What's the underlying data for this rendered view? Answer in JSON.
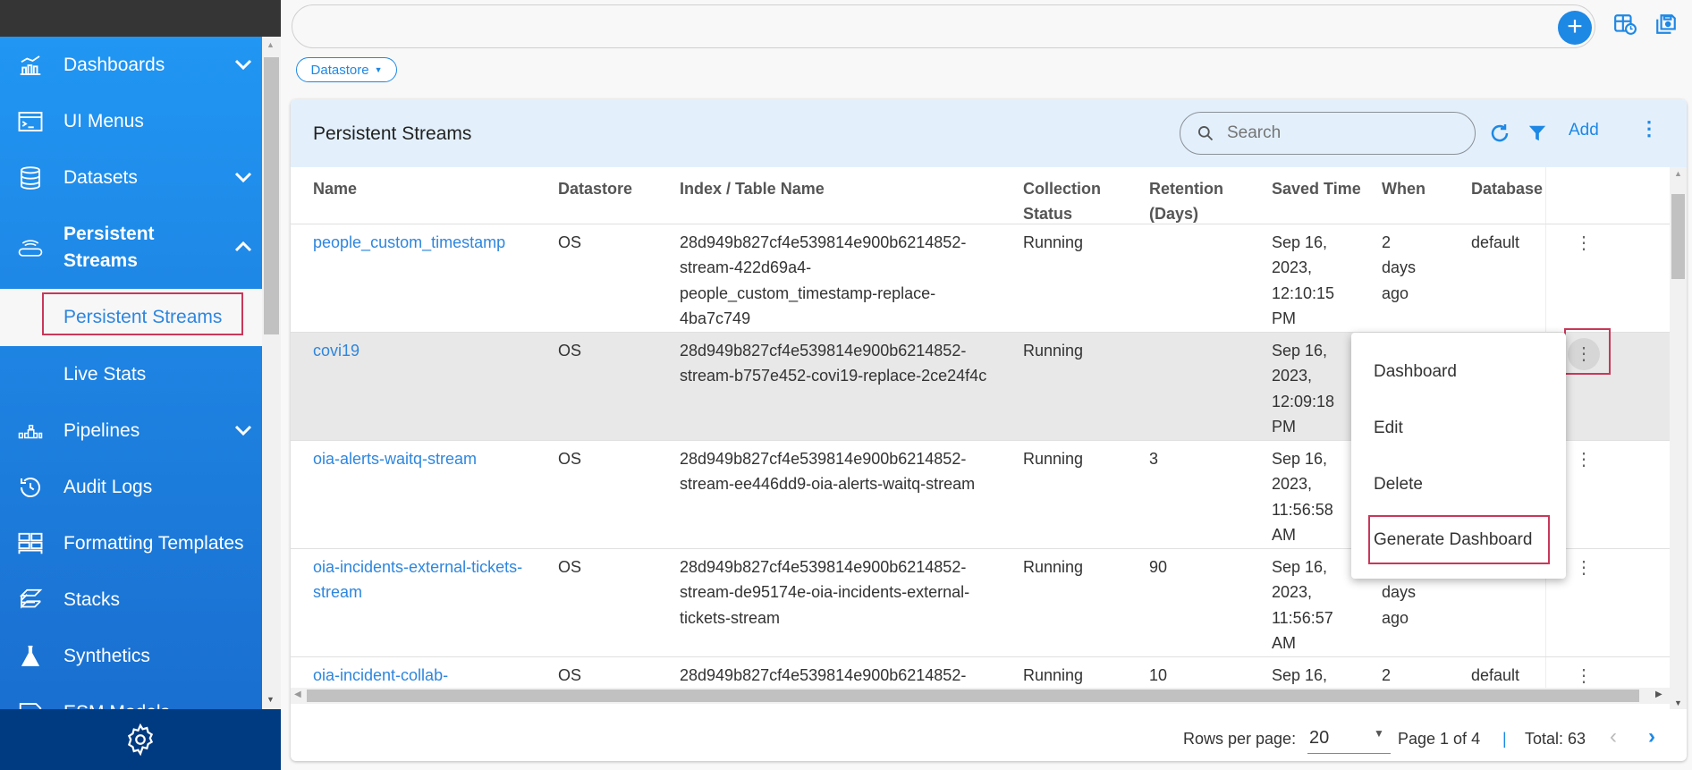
{
  "sidebar": {
    "items": [
      {
        "label": "Dashboards",
        "icon": "bar-chart-icon",
        "chevron": "down"
      },
      {
        "label": "UI Menus",
        "icon": "terminal-window-icon"
      },
      {
        "label": "Datasets",
        "icon": "database-icon",
        "chevron": "down"
      },
      {
        "label": "Persistent Streams",
        "icon": "router-icon",
        "chevron": "up",
        "active": true
      },
      {
        "label": "Persistent Streams",
        "sub": true,
        "selected": true
      },
      {
        "label": "Live Stats",
        "sub": true
      },
      {
        "label": "Pipelines",
        "icon": "pipeline-icon",
        "chevron": "down"
      },
      {
        "label": "Audit Logs",
        "icon": "history-icon"
      },
      {
        "label": "Formatting Templates",
        "icon": "template-icon"
      },
      {
        "label": "Stacks",
        "icon": "stack-icon"
      },
      {
        "label": "Synthetics",
        "icon": "flask-icon"
      },
      {
        "label": "ESM Models",
        "icon": "document-icon"
      }
    ],
    "footer_icon": "settings-gear-icon"
  },
  "toolbar": {
    "chip_label": "Datastore"
  },
  "card": {
    "title": "Persistent Streams",
    "search_placeholder": "Search",
    "add_label": "Add"
  },
  "table": {
    "columns": [
      "Name",
      "Datastore",
      "Index / Table Name",
      "Collection Status",
      "Retention (Days)",
      "Saved Time",
      "When",
      "Database"
    ],
    "rows": [
      {
        "name": "people_custom_timestamp",
        "datastore": "OS",
        "index": "28d949b827cf4e539814e900b6214852-stream-422d69a4-people_custom_timestamp-replace-4ba7c749",
        "status": "Running",
        "retention": "",
        "saved": "Sep 16, 2023, 12:10:15 PM",
        "when": "2 days ago",
        "database": "default"
      },
      {
        "name": "covi19",
        "datastore": "OS",
        "index": "28d949b827cf4e539814e900b6214852-stream-b757e452-covi19-replace-2ce24f4c",
        "status": "Running",
        "retention": "",
        "saved": "Sep 16, 2023, 12:09:18 PM",
        "when": "",
        "database": "",
        "highlighted": true
      },
      {
        "name": "oia-alerts-waitq-stream",
        "datastore": "OS",
        "index": "28d949b827cf4e539814e900b6214852-stream-ee446dd9-oia-alerts-waitq-stream",
        "status": "Running",
        "retention": "3",
        "saved": "Sep 16, 2023, 11:56:58 AM",
        "when": "",
        "database": ""
      },
      {
        "name": "oia-incidents-external-tickets-stream",
        "datastore": "OS",
        "index": "28d949b827cf4e539814e900b6214852-stream-de95174e-oia-incidents-external-tickets-stream",
        "status": "Running",
        "retention": "90",
        "saved": "Sep 16, 2023, 11:56:57 AM",
        "when": "2 days ago",
        "database": ""
      },
      {
        "name": "oia-incident-collab-",
        "datastore": "OS",
        "index": "28d949b827cf4e539814e900b6214852-",
        "status": "Running",
        "retention": "10",
        "saved": "Sep 16,",
        "when": "2",
        "database": "default"
      }
    ]
  },
  "pagination": {
    "rows_per_page_label": "Rows per page:",
    "rows_per_page": "20",
    "page_text": "Page 1 of 4",
    "separator": "|",
    "total_text": "Total: 63"
  },
  "menu": {
    "items": [
      "Dashboard",
      "Edit",
      "Delete",
      "Generate Dashboard"
    ]
  },
  "colors": {
    "accent": "#1e88e5",
    "sidebar_top": "#2196f3",
    "sidebar_footer": "#003a80",
    "highlight_border": "#c8385a"
  }
}
